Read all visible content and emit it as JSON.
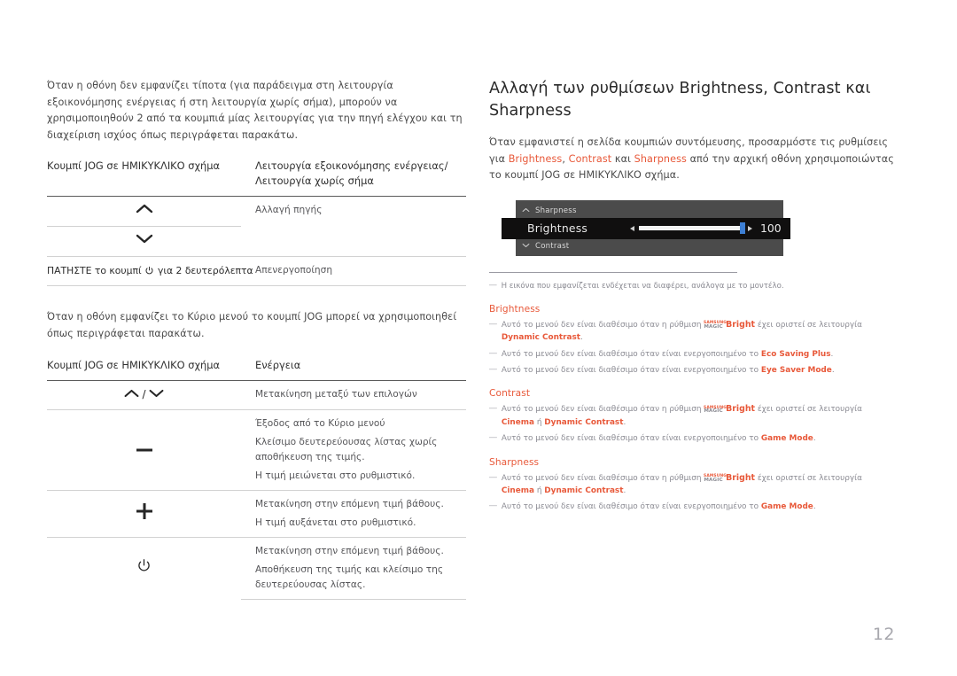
{
  "left": {
    "intro_paragraph": "Όταν η οθόνη δεν εμφανίζει τίποτα (για παράδειγμα στη λειτουργία εξοικονόμησης ενέργειας ή στη λειτουργία χωρίς σήμα), μπορούν να χρησιμοποιηθούν 2 από τα κουμπιά μίας λειτουργίας για την πηγή ελέγχου και τη διαχείριση ισχύος όπως περιγράφεται παρακάτω.",
    "table1": {
      "header_key": "Κουμπί JOG σε ΗΜΙΚΥΚΛΙΚΟ σχήμα",
      "header_action": "Λειτουργία εξοικονόμησης ενέργειας/Λειτουργία χωρίς σήμα",
      "rows": [
        {
          "key_icon": "chevron-up-icon",
          "key_glyph": "⌃",
          "action": "Αλλαγή πηγής"
        },
        {
          "key_icon": "chevron-down-icon",
          "key_glyph": "⌄",
          "action": ""
        },
        {
          "key_icon": "power-icon",
          "key_text_before": "ΠΑΤΗΣΤΕ το κουμπί",
          "key_text_after": "για 2 δευτερόλεπτα",
          "action": "Απενεργοποίηση"
        }
      ]
    },
    "intro_paragraph2": "Όταν η οθόνη εμφανίζει το Κύριο μενού το κουμπί JOG μπορεί να χρησιμοποιηθεί όπως περιγράφεται παρακάτω.",
    "table2": {
      "header_key": "Κουμπί JOG σε ΗΜΙΚΥΚΛΙΚΟ σχήμα",
      "header_action": "Ενέργεια",
      "rows": [
        {
          "key_icon": "chevron-up-down-icon",
          "actions": [
            "Μετακίνηση μεταξύ των επιλογών"
          ]
        },
        {
          "key_icon": "minus-icon",
          "key_glyph": "—",
          "actions": [
            "Έξοδος από το Κύριο μενού",
            "Κλείσιμο δευτερεύουσας λίστας χωρίς αποθήκευση της τιμής.",
            "Η τιμή μειώνεται στο ρυθμιστικό."
          ]
        },
        {
          "key_icon": "plus-icon",
          "key_glyph": "+",
          "actions": [
            "Μετακίνηση στην επόμενη τιμή βάθους.",
            "Η τιμή αυξάνεται στο ρυθμιστικό."
          ]
        },
        {
          "key_icon": "power-icon",
          "key_glyph": "⏻",
          "actions": [
            "Μετακίνηση στην επόμενη τιμή βάθους.",
            "Αποθήκευση της τιμής και κλείσιμο της δευτερεύουσας λίστας."
          ]
        }
      ]
    }
  },
  "right": {
    "title": "Αλλαγή των ρυθμίσεων Brightness, Contrast και Sharpness",
    "intro": {
      "p1": "Όταν εμφανιστεί η σελίδα κουμπιών συντόμευσης, προσαρμόστε τις ρυθμίσεις για ",
      "t1": "Brightness",
      "p2": ", ",
      "t2": "Contrast",
      "p3": " και ",
      "t3": "Sharpness",
      "p4": " από την αρχική οθόνη χρησιμοποιώντας το κουμπί JOG σε ΗΜΙΚΥΚΛΙΚΟ σχήμα."
    },
    "osd": {
      "top_label": "Sharpness",
      "top_arrow_icon": "chevron-up-icon",
      "main_label": "Brightness",
      "value": "100",
      "left_arrow_icon": "triangle-left-icon",
      "right_arrow_icon": "triangle-right-icon",
      "bottom_label": "Contrast",
      "bottom_arrow_icon": "chevron-down-icon"
    },
    "note": "Η εικόνα που εμφανίζεται ενδέχεται να διαφέρει, ανάλογα με το μοντέλο.",
    "sections": [
      {
        "heading": "Brightness",
        "bullets": [
          {
            "pre": "Αυτό το μενού δεν είναι διαθέσιμο όταν η ρύθμιση ",
            "logo": true,
            "logo_samsung": "SAMSUNG",
            "logo_magic": "MAGIC",
            "logo_bright": "Bright",
            "mid": " έχει οριστεί σε λειτουργία ",
            "term1": "Dynamic Contrast",
            "post": "."
          },
          {
            "pre": "Αυτό το μενού δεν είναι διαθέσιμο όταν είναι ενεργοποιημένο το ",
            "term1": "Eco Saving Plus",
            "post": "."
          },
          {
            "pre": "Αυτό το μενού δεν είναι διαθέσιμο όταν είναι ενεργοποιημένο το ",
            "term1": "Eye Saver Mode",
            "post": "."
          }
        ]
      },
      {
        "heading": "Contrast",
        "bullets": [
          {
            "pre": "Αυτό το μενού δεν είναι διαθέσιμο όταν η ρύθμιση ",
            "logo": true,
            "logo_samsung": "SAMSUNG",
            "logo_magic": "MAGIC",
            "logo_bright": "Bright",
            "mid": " έχει οριστεί σε λειτουργία ",
            "term1": "Cinema",
            "conj": " ή ",
            "term2": "Dynamic Contrast",
            "post": "."
          },
          {
            "pre": "Αυτό το μενού δεν είναι διαθέσιμο όταν είναι ενεργοποιημένο το ",
            "term1": "Game Mode",
            "post": "."
          }
        ]
      },
      {
        "heading": "Sharpness",
        "bullets": [
          {
            "pre": "Αυτό το μενού δεν είναι διαθέσιμο όταν η ρύθμιση ",
            "logo": true,
            "logo_samsung": "SAMSUNG",
            "logo_magic": "MAGIC",
            "logo_bright": "Bright",
            "mid": " έχει οριστεί σε λειτουργία ",
            "term1": "Cinema",
            "conj": " ή ",
            "term2": "Dynamic Contrast",
            "post": "."
          },
          {
            "pre": "Αυτό το μενού δεν είναι διαθέσιμο όταν είναι ενεργοποιημένο το ",
            "term1": "Game Mode",
            "post": "."
          }
        ]
      }
    ]
  },
  "page_number": "12",
  "colors": {
    "accent": "#e8593a",
    "body_text": "#4a4a4a",
    "muted_text": "#8b8b93",
    "osd_panel": "#4b4b4b",
    "osd_bar": "#100f0f",
    "osd_knob": "#3d7fd4"
  }
}
